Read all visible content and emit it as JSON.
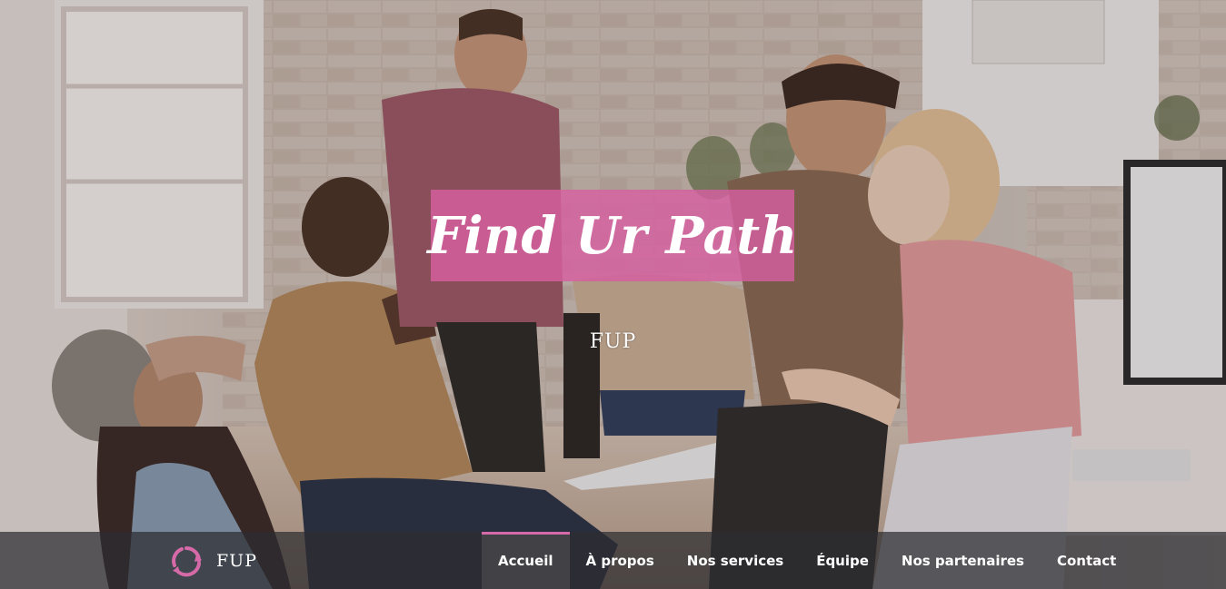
{
  "hero": {
    "title": "Find Ur Path",
    "subtitle": "FUP",
    "accent_color": "#d65fa0"
  },
  "navbar": {
    "brand_name": "FUP",
    "logo_icon": "circular-arrows-logo",
    "items": [
      {
        "label": "Accueil",
        "active": true
      },
      {
        "label": "À propos",
        "active": false
      },
      {
        "label": "Nos services",
        "active": false
      },
      {
        "label": "Équipe",
        "active": false
      },
      {
        "label": "Nos partenaires",
        "active": false
      },
      {
        "label": "Contact",
        "active": false
      }
    ],
    "active_indicator_color": "#d66aa8"
  }
}
